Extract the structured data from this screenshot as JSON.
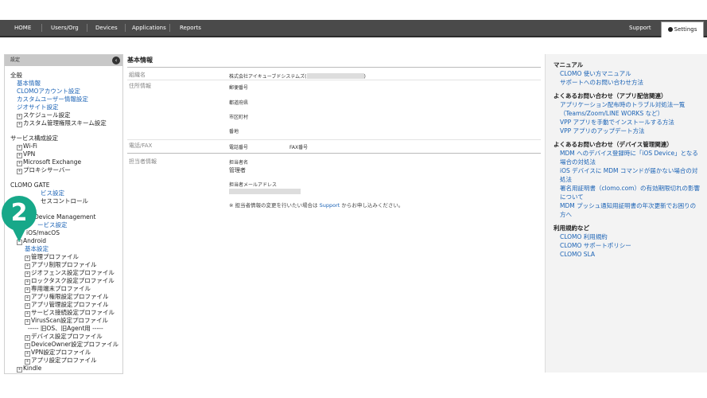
{
  "nav": {
    "items": [
      "HOME",
      "Users/Org",
      "Devices",
      "Applications",
      "Reports"
    ],
    "support": "Support",
    "settings": "Settings"
  },
  "sidebar": {
    "header": "設定",
    "general_title": "全般",
    "general_links": [
      "基本情報",
      "CLOMOアカウント設定",
      "カスタムユーザー情報設定",
      "ジオサイト設定"
    ],
    "general_items": [
      "スケジュール設定",
      "カスタム管理権限スキーム設定"
    ],
    "service_title": "サービス構成設定",
    "service_items": [
      "Wi-Fi",
      "VPN",
      "Microsoft Exchange",
      "プロキシサーバー"
    ],
    "gate_title": "CLOMO GATE",
    "gate_items": [
      "ビス設定",
      "セスコントロール"
    ],
    "device_mgmt_title": "Device Management",
    "device_mgmt_link": "ービス設定",
    "ios": "iOS/macOS",
    "android": "Android",
    "android_basic": "基本設定",
    "android_items": [
      "管理プロファイル",
      "アプリ制限プロファイル",
      "ジオフェンス設定プロファイル",
      "ロックタスク設定プロファイル",
      "専用端末プロファイル",
      "アプリ権限設定プロファイル",
      "アプリ管理設定プロファイル",
      "サービス接続設定プロファイル",
      "VirusScan設定プロファイル"
    ],
    "old_os_label": "----- 旧OS、旧Agent用 -----",
    "android_old_items": [
      "デバイス設定プロファイル",
      "DeviceOwner設定プロファイル",
      "VPN設定プロファイル",
      "アプリ設定プロファイル"
    ],
    "kindle": "Kindle"
  },
  "badge_number": "2",
  "main": {
    "title": "基本情報",
    "org_label": "組織名",
    "org_value": "株式会社アイキューブドシステムズ(",
    "org_value_end": ")",
    "address_label": "住所情報",
    "postal": "郵便番号",
    "prefecture": "都道府県",
    "city": "市区町村",
    "street": "番地",
    "phone_label": "電話/FAX",
    "phone": "電話番号",
    "fax": "FAX番号",
    "contact_label": "担当者情報",
    "contact_name_label": "担当者名",
    "contact_name": "管理者",
    "contact_email_label": "担当者メールアドレス",
    "note_prefix": "※ 担当者情報の変更を行いたい場合は",
    "note_link": "Support",
    "note_suffix": "からお申し込みください。"
  },
  "right": {
    "manual_title": "マニュアル",
    "manual_links": [
      "CLOMO 使い方マニュアル",
      "サポートへのお問い合わせ方法"
    ],
    "faq_app_title": "よくあるお問い合わせ（アプリ配信関連）",
    "faq_app_links": [
      "アプリケーション配布時のトラブル対処法一覧（Teams/Zoom/LINE WORKS など）",
      "VPP アプリを手動でインストールする方法",
      "VPP アプリのアップデート方法"
    ],
    "faq_dev_title": "よくあるお問い合わせ（デバイス管理関連）",
    "faq_dev_links": [
      "MDM へのデバイス登録時に「iOS Device」となる場合の対処法",
      "iOS デバイスに MDM コマンドが届かない場合の対処法",
      "署名用証明書（clomo.com）の有効期限切れの影響について",
      "MDM プッシュ通知用証明書の年次更新でお困りの方へ"
    ],
    "terms_title": "利用規約など",
    "terms_links": [
      "CLOMO 利用規約",
      "CLOMO サポートポリシー",
      "CLOMO SLA"
    ]
  }
}
